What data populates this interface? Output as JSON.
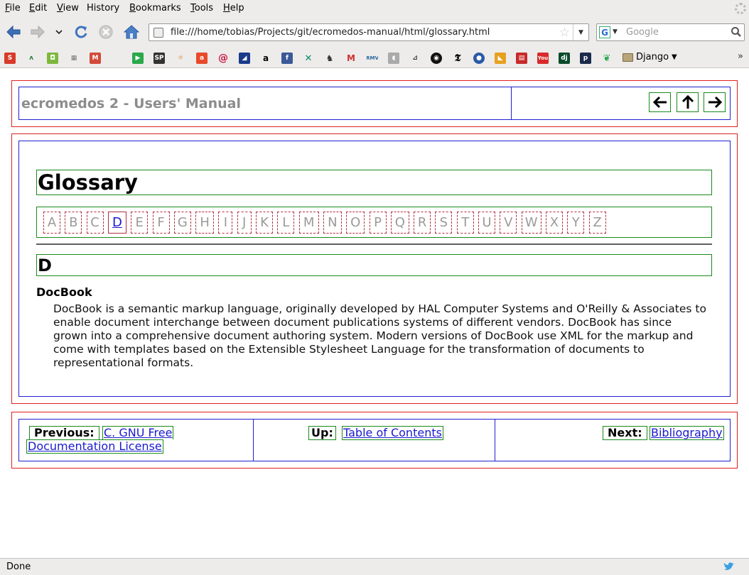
{
  "browser": {
    "menu": [
      {
        "label": "File",
        "accel": "F",
        "rest": "ile"
      },
      {
        "label": "Edit",
        "accel": "E",
        "rest": "dit"
      },
      {
        "label": "View",
        "accel": "V",
        "rest": "iew"
      },
      {
        "label": "History",
        "accel": "",
        "rest": "History"
      },
      {
        "label": "Bookmarks",
        "accel": "B",
        "rest": "ookmarks"
      },
      {
        "label": "Tools",
        "accel": "T",
        "rest": "ools"
      },
      {
        "label": "Help",
        "accel": "H",
        "rest": "elp"
      }
    ],
    "url": "file:///home/tobias/Projects/git/ecromedos-manual/html/glossary.html",
    "search_placeholder": "Google",
    "search_engine": "G",
    "bookmarks_folder": "Django",
    "status": "Done"
  },
  "page": {
    "header_title": "ecromedos 2 - Users' Manual",
    "glossary_title": "Glossary",
    "letters": [
      "A",
      "B",
      "C",
      "D",
      "E",
      "F",
      "G",
      "H",
      "I",
      "J",
      "K",
      "L",
      "M",
      "N",
      "O",
      "P",
      "Q",
      "R",
      "S",
      "T",
      "U",
      "V",
      "W",
      "X",
      "Y",
      "Z"
    ],
    "active_letter": "D",
    "section_letter": "D",
    "term": "DocBook",
    "definition": "DocBook is a semantic markup language, originally developed by HAL Computer Systems and O'Reilly & Associates to enable document interchange between document publications systems of different vendors. DocBook has since grown into a comprehensive document authoring system. Modern versions of DocBook use XML for the markup and come with templates based on the Extensible Stylesheet Language for the transformation of documents to representational formats.",
    "footer": {
      "previous_label": "Previous:",
      "previous_link_line1": "C. GNU Free",
      "previous_link_line2": "Documentation License",
      "up_label": "Up:",
      "up_link": "Table of Contents",
      "next_label": "Next:",
      "next_link": "Bibliography"
    }
  },
  "colors": {
    "chrome": "#edeceb",
    "outer_border": "#e02020",
    "inner_border": "#2020d0",
    "debug_border": "#1a8a1a",
    "link": "#1a1ad0"
  }
}
